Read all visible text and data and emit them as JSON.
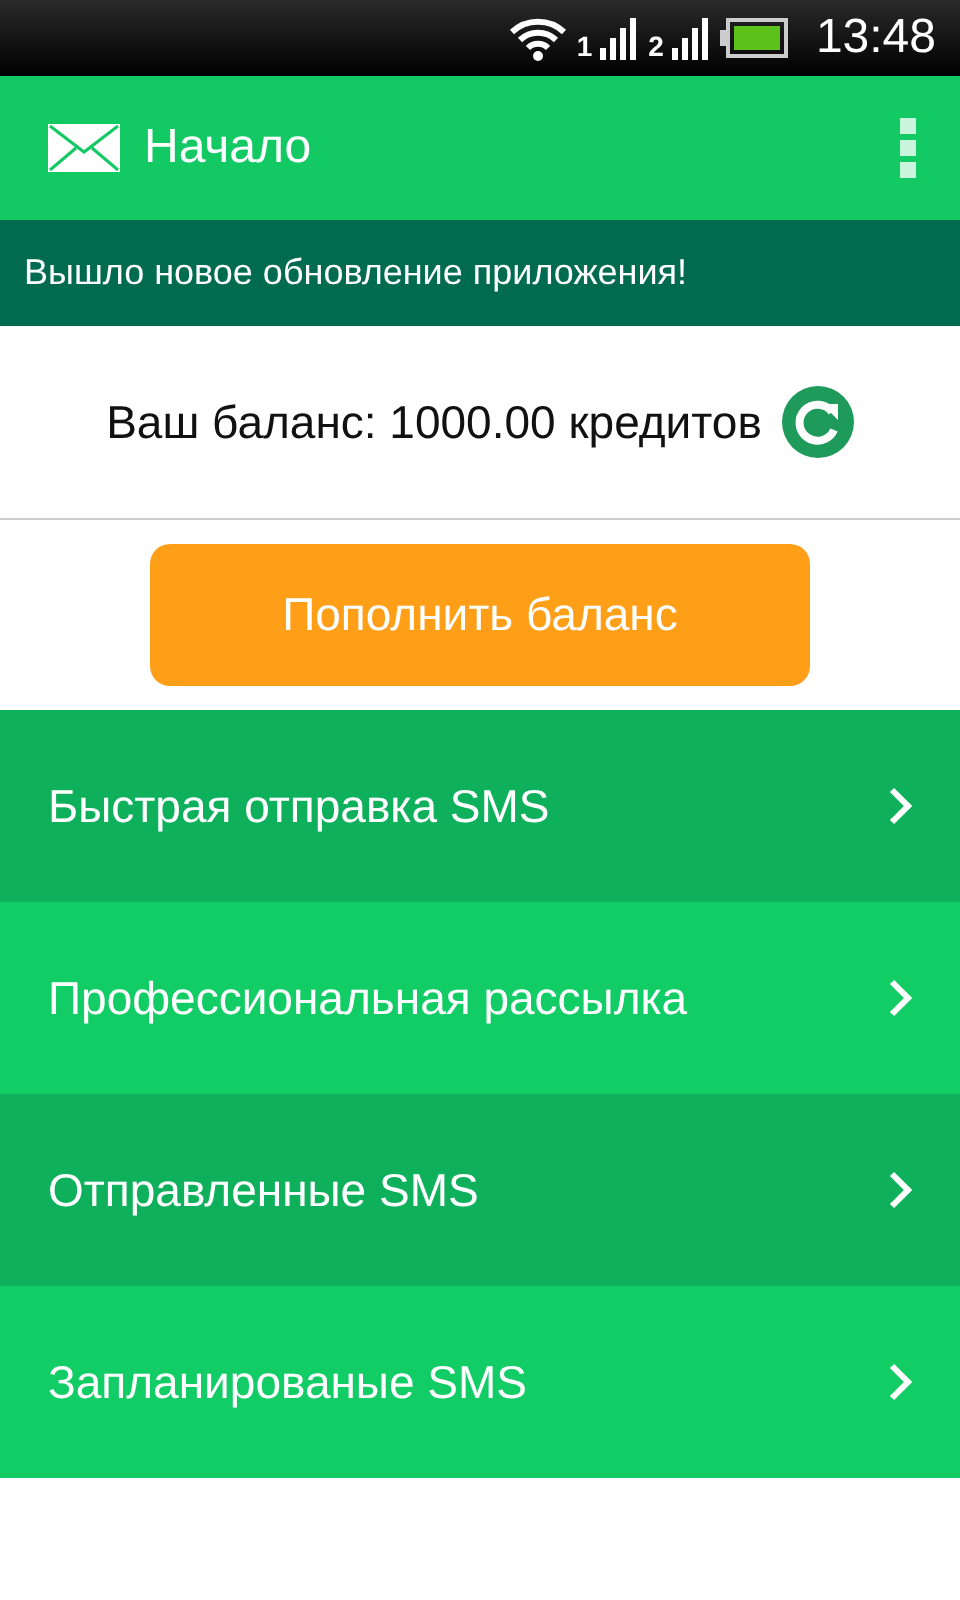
{
  "status_bar": {
    "sim_1": "1",
    "sim_2": "2",
    "time": "13:48"
  },
  "app_bar": {
    "title": "Начало"
  },
  "banner": {
    "text": "Вышло новое обновление приложения!"
  },
  "balance": {
    "text": "Ваш баланс: 1000.00 кредитов"
  },
  "top_up_button": {
    "label": "Пополнить баланс"
  },
  "menu": [
    {
      "label": "Быстрая отправка SMS"
    },
    {
      "label": "Профессиональная рассылка"
    },
    {
      "label": "Отправленные SMS"
    },
    {
      "label": "Запланированые SMS"
    }
  ]
}
